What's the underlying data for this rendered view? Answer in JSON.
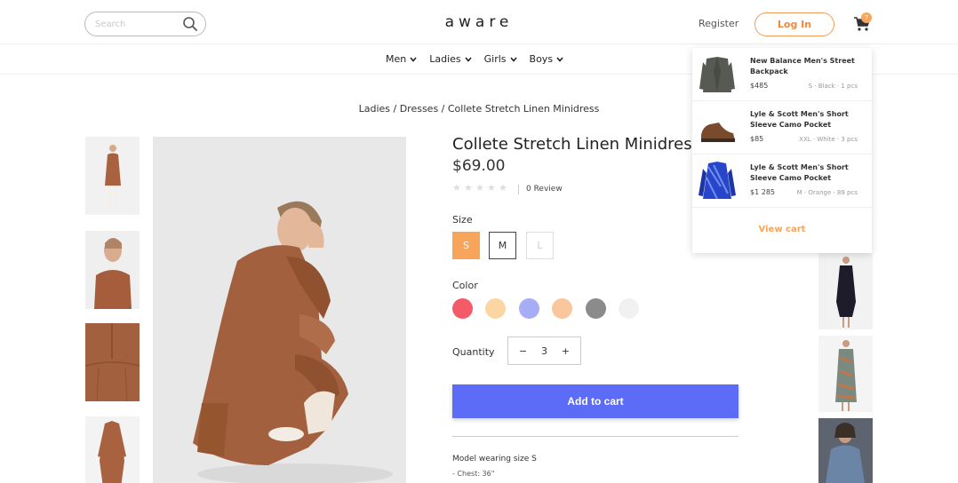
{
  "header": {
    "search_placeholder": "Search",
    "logo": "aware",
    "register_label": "Register",
    "login_label": "Log In",
    "cart_count": "7",
    "accent_color": "#f8a55c"
  },
  "nav": {
    "items": [
      {
        "label": "Men"
      },
      {
        "label": "Ladies"
      },
      {
        "label": "Girls"
      },
      {
        "label": "Boys"
      }
    ]
  },
  "breadcrumb": "Ladies / Dresses / Collete Stretch Linen Minidress",
  "product": {
    "title": "Collete Stretch Linen Minidress",
    "price": "$69.00",
    "rating": 0,
    "review_label": "0 Review",
    "size_label": "Size",
    "sizes": [
      "S",
      "M",
      "L"
    ],
    "selected_size": "S",
    "color_label": "Color",
    "colors": [
      "#f45b68",
      "#fbd6a3",
      "#a6adf6",
      "#f9c79b",
      "#8b8b8b",
      "#f1f1f1"
    ],
    "quantity_label": "Quantity",
    "quantity": "3",
    "qty_minus": "−",
    "qty_plus": "+",
    "add_to_cart": "Add to cart",
    "model_note": "Model wearing size S",
    "chest_note": "- Chest: 36\""
  },
  "cart_dropdown": {
    "items": [
      {
        "name": "New Balance Men's Street Backpack",
        "price": "$485",
        "meta": "S · Black · 1 pcs"
      },
      {
        "name": "Lyle & Scott Men's Short Sleeve Camo Pocket",
        "price": "$85",
        "meta": "XXL · White · 3 pcs"
      },
      {
        "name": "Lyle & Scott Men's Short Sleeve Camo Pocket",
        "price": "$1 285",
        "meta": "M · Orange · 89 pcs"
      }
    ],
    "view_cart": "View cart"
  }
}
